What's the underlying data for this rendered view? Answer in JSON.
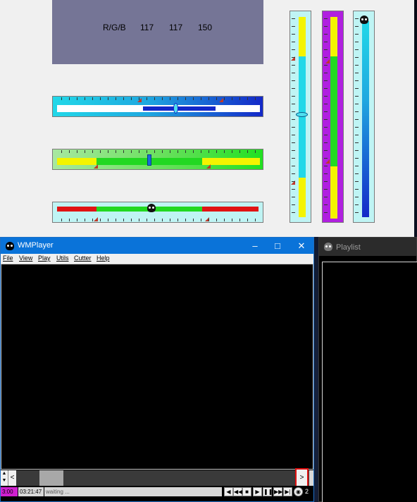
{
  "demo": {
    "rgb_label": "R/G/B",
    "r": "117",
    "g": "117",
    "b": "150",
    "panel_color": "#757596"
  },
  "wmplayer": {
    "title": "WMPlayer",
    "menu": [
      "File",
      "View",
      "Play",
      "Utils",
      "Cutter",
      "Help"
    ],
    "time_elapsed": "3:00",
    "time_total": "03:21:47",
    "status": "waiting ...",
    "seek_left": "<",
    "seek_right": ">",
    "volume": "2",
    "titlebar_color": "#0a73d9"
  },
  "playlist": {
    "title": "Playlist"
  },
  "icons": {
    "minimize": "minimize-icon",
    "maximize": "maximize-icon",
    "close": "close-icon",
    "app": "skull-icon"
  }
}
